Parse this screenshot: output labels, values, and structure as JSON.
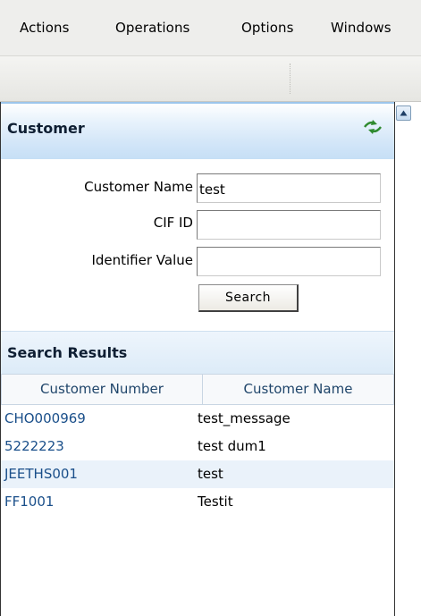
{
  "menubar": {
    "items": [
      "Actions",
      "Operations",
      "Options",
      "Windows"
    ]
  },
  "panel": {
    "title": "Customer",
    "refresh_icon": "refresh-icon",
    "accent_color": "#c6dff6"
  },
  "form": {
    "customer_name_label": "Customer Name",
    "customer_name_value": "test",
    "cif_id_label": "CIF ID",
    "cif_id_value": "",
    "identifier_value_label": "Identifier Value",
    "identifier_value_value": "",
    "search_label": "Search"
  },
  "results": {
    "title": "Search Results",
    "columns": [
      "Customer Number",
      "Customer Name"
    ],
    "rows": [
      {
        "number": "CHO000969",
        "name": "test_message"
      },
      {
        "number": "5222223",
        "name": "test dum1"
      },
      {
        "number": "JEETHS001",
        "name": "test"
      },
      {
        "number": "FF1001",
        "name": "Testit"
      }
    ]
  },
  "scrollbar": {
    "icon": "scroll-up-arrow-icon"
  }
}
